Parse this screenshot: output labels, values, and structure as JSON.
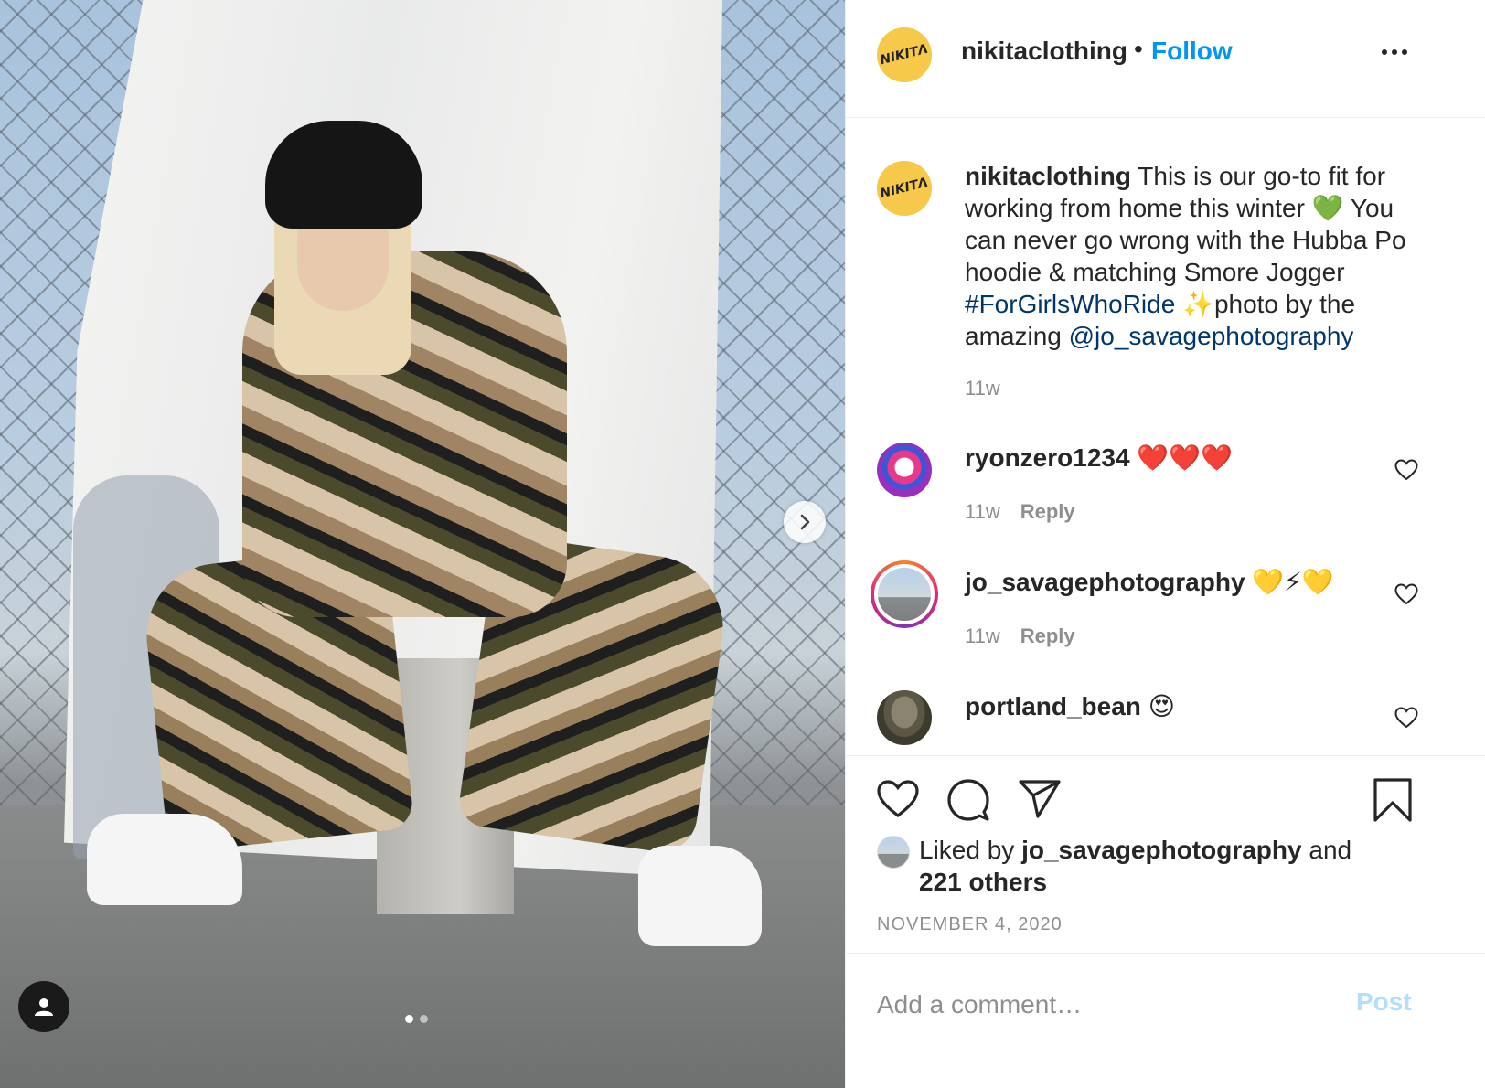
{
  "post": {
    "account": "nikitaclothing",
    "follow_label": "Follow",
    "separator": "•",
    "logo_text": "ΝΙΚΙΤΛ",
    "carousel": {
      "slide_count": 2,
      "active_slide": 1
    }
  },
  "caption": {
    "username": "nikitaclothing",
    "text_part1": "This is our go-to fit for working from home this winter",
    "emoji1": "💚",
    "text_part2": "You can never go wrong with the Hubba Po hoodie & matching Smore Jogger",
    "hashtag": "#ForGirlsWhoRide",
    "emoji2": "✨",
    "text_part3": "photo by the amazing",
    "mention": "@jo_savagephotography",
    "age": "11w"
  },
  "comments": [
    {
      "username": "ryonzero1234",
      "text": "❤️❤️❤️",
      "age": "11w",
      "reply_label": "Reply"
    },
    {
      "username": "jo_savagephotography",
      "text": "💛⚡💛",
      "age": "11w",
      "reply_label": "Reply"
    },
    {
      "username": "portland_bean",
      "text": "😍"
    }
  ],
  "likes": {
    "prefix": "Liked by",
    "user": "jo_savagephotography",
    "connector": "and",
    "others": "221 others"
  },
  "date": "NOVEMBER 4, 2020",
  "comment_box": {
    "placeholder": "Add a comment…",
    "post_label": "Post"
  },
  "colors": {
    "follow_blue": "#0095f6",
    "post_disabled": "#b2dffc",
    "link_blue": "#00376b",
    "muted_gray": "#8e8e8e",
    "logo_yellow": "#f6c94a"
  },
  "icons": [
    "chevron-right-icon",
    "user-tag-icon",
    "more-options-icon",
    "heart-icon",
    "comment-icon",
    "share-icon",
    "bookmark-icon"
  ]
}
